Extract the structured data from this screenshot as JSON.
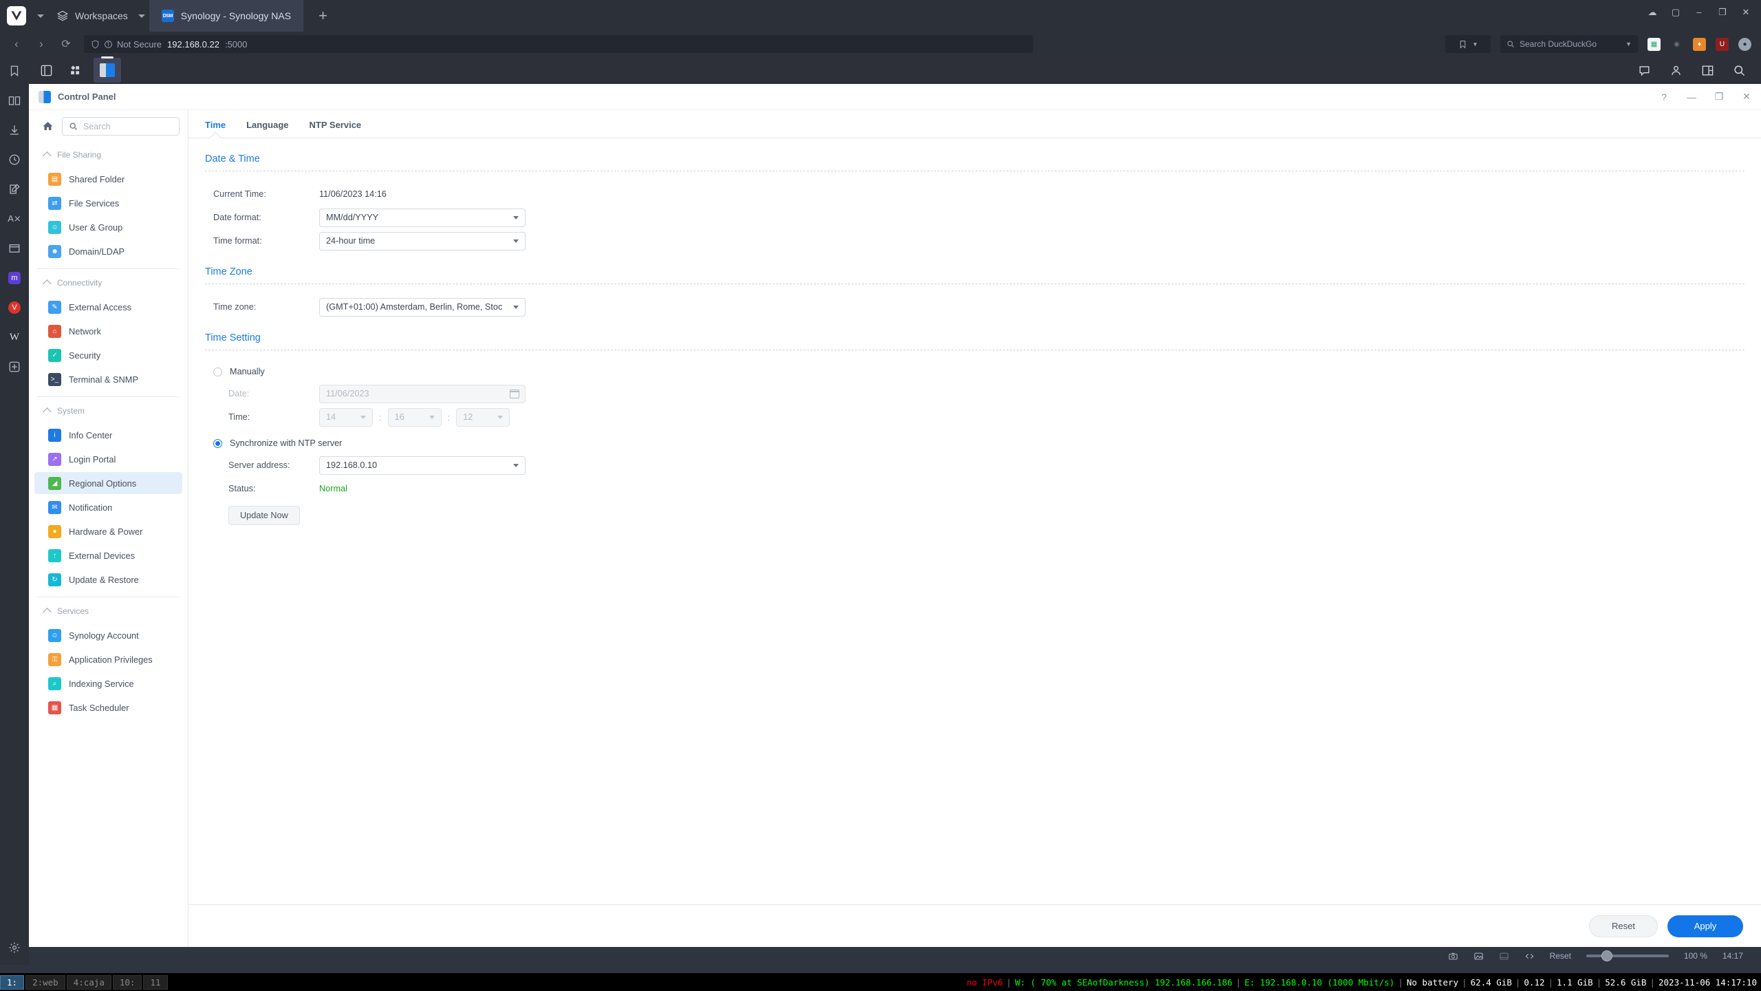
{
  "browser": {
    "workspaces_label": "Workspaces",
    "tab_title": "Synology - Synology NAS",
    "favicon_text": "DSM",
    "newtab_label": "+",
    "window_min": "–",
    "window_max": "❐",
    "window_close": "✕",
    "security_label": "Not Secure",
    "url_host": "192.168.0.22",
    "url_port": ":5000",
    "search_placeholder": "Search DuckDuckGo",
    "status": {
      "reset_label": "Reset",
      "zoom_level": "100 %",
      "clock": "14:17"
    }
  },
  "dsm": {
    "window_title": "Control Panel",
    "help_label": "?",
    "minimize_label": "—",
    "restore_label": "❐",
    "close_label": "✕",
    "search_placeholder": "Search",
    "nav_groups": [
      {
        "title": "File Sharing",
        "items": [
          {
            "label": "Shared Folder",
            "icon": "shared-folder-icon",
            "color": "#f5a03c",
            "glyph": "▤"
          },
          {
            "label": "File Services",
            "icon": "file-services-icon",
            "color": "#3d9ef2",
            "glyph": "⇄"
          },
          {
            "label": "User & Group",
            "icon": "user-group-icon",
            "color": "#2fc3d9",
            "glyph": "☺"
          },
          {
            "label": "Domain/LDAP",
            "icon": "domain-ldap-icon",
            "color": "#4aa3f0",
            "glyph": "☻"
          }
        ]
      },
      {
        "title": "Connectivity",
        "items": [
          {
            "label": "External Access",
            "icon": "external-access-icon",
            "color": "#3d9ef2",
            "glyph": "✎"
          },
          {
            "label": "Network",
            "icon": "network-icon",
            "color": "#e0563c",
            "glyph": "⌂"
          },
          {
            "label": "Security",
            "icon": "security-icon",
            "color": "#19c4b0",
            "glyph": "✓"
          },
          {
            "label": "Terminal & SNMP",
            "icon": "terminal-snmp-icon",
            "color": "#3c4a63",
            "glyph": ">_"
          }
        ]
      },
      {
        "title": "System",
        "items": [
          {
            "label": "Info Center",
            "icon": "info-center-icon",
            "color": "#1f7ae0",
            "glyph": "i"
          },
          {
            "label": "Login Portal",
            "icon": "login-portal-icon",
            "color": "#9b6ff0",
            "glyph": "↗"
          },
          {
            "label": "Regional Options",
            "icon": "regional-options-icon",
            "color": "#4db84d",
            "glyph": "◢",
            "active": true
          },
          {
            "label": "Notification",
            "icon": "notification-icon",
            "color": "#2f8ff0",
            "glyph": "✉"
          },
          {
            "label": "Hardware & Power",
            "icon": "hardware-power-icon",
            "color": "#f5a81c",
            "glyph": "●"
          },
          {
            "label": "External Devices",
            "icon": "external-devices-icon",
            "color": "#1ec8c8",
            "glyph": "↑"
          },
          {
            "label": "Update & Restore",
            "icon": "update-restore-icon",
            "color": "#17b8d4",
            "glyph": "↻"
          }
        ]
      },
      {
        "title": "Services",
        "items": [
          {
            "label": "Synology Account",
            "icon": "synology-account-icon",
            "color": "#2f9ff0",
            "glyph": "☺"
          },
          {
            "label": "Application Privileges",
            "icon": "application-privileges-icon",
            "color": "#f5a03c",
            "glyph": "⚿"
          },
          {
            "label": "Indexing Service",
            "icon": "indexing-service-icon",
            "color": "#1ec8c8",
            "glyph": "⌕"
          },
          {
            "label": "Task Scheduler",
            "icon": "task-scheduler-icon",
            "color": "#e8524a",
            "glyph": "▦"
          }
        ]
      }
    ],
    "tabs": [
      {
        "label": "Time",
        "active": true
      },
      {
        "label": "Language",
        "active": false
      },
      {
        "label": "NTP Service",
        "active": false
      }
    ],
    "date_time": {
      "section_title": "Date & Time",
      "current_time_label": "Current Time:",
      "current_time_value": "11/06/2023 14:16",
      "date_format_label": "Date format:",
      "date_format_value": "MM/dd/YYYY",
      "time_format_label": "Time format:",
      "time_format_value": "24-hour time"
    },
    "time_zone": {
      "section_title": "Time Zone",
      "label": "Time zone:",
      "value": "(GMT+01:00) Amsterdam, Berlin, Rome, Stoc"
    },
    "time_setting": {
      "section_title": "Time Setting",
      "manual_label": "Manually",
      "manual_selected": false,
      "date_label": "Date:",
      "date_value": "11/06/2023",
      "time_label": "Time:",
      "time_hour": "14",
      "time_minute": "16",
      "time_second": "12",
      "time_separator": ":",
      "ntp_label": "Synchronize with NTP server",
      "ntp_selected": true,
      "server_address_label": "Server address:",
      "server_address_value": "192.168.0.10",
      "status_label": "Status:",
      "status_value": "Normal",
      "status_color": "#17a81a",
      "update_now_label": "Update Now"
    },
    "footer": {
      "reset_label": "Reset",
      "apply_label": "Apply"
    }
  },
  "i3bar": {
    "workspaces": [
      {
        "label": "1:",
        "active": true
      },
      {
        "label": "2:web",
        "active": false
      },
      {
        "label": "4:caja",
        "active": false
      },
      {
        "label": "10:",
        "active": false
      },
      {
        "label": "11",
        "active": false
      }
    ],
    "ipv6": "no IPv6",
    "wifi": "W: ( 70% at SEAofDarkness) 192.168.166.186",
    "ethernet": "E: 192.168.0.10 (1000 Mbit/s)",
    "battery": "No battery",
    "disk1": "62.4 GiB",
    "load": "0.12",
    "mem1": "1.1 GiB",
    "mem2": "52.6 GiB",
    "datetime": "2023-11-06 14:17:10",
    "separator": "|"
  }
}
